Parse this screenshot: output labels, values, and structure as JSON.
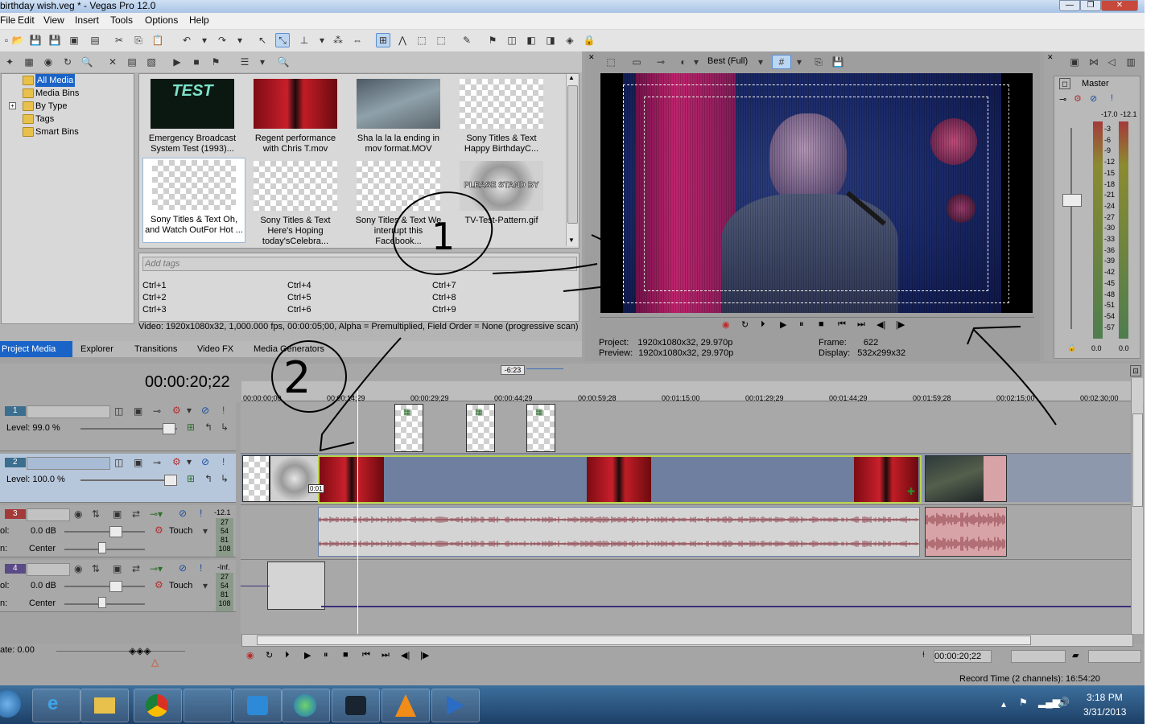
{
  "window": {
    "title": "birthday wish.veg * - Vegas Pro 12.0",
    "minimize": "—",
    "maximize": "❐",
    "close": "✕"
  },
  "menu": [
    "File",
    "Edit",
    "View",
    "Insert",
    "Tools",
    "Options",
    "Help"
  ],
  "media_tree": {
    "items": [
      "All Media",
      "Media Bins",
      "By Type",
      "Tags",
      "Smart Bins"
    ]
  },
  "media_items": [
    {
      "label": "Emergency Broadcast System Test (1993)...",
      "thumb": "TEST"
    },
    {
      "label": "Regent performance with Chris T.mov",
      "thumb": ""
    },
    {
      "label": "Sha la la la ending in mov format.MOV",
      "thumb": ""
    },
    {
      "label": "Sony Titles & Text Happy BirthdayC...",
      "thumb": ""
    },
    {
      "label": "Sony Titles & Text Oh, and Watch OutFor Hot ...",
      "thumb": ""
    },
    {
      "label": "Sony Titles & Text Here's Hoping today'sCelebra...",
      "thumb": ""
    },
    {
      "label": "Sony Titles & Text We interrupt this Facebook...",
      "thumb": ""
    },
    {
      "label": "TV-Test-Pattern.gif",
      "thumb": "PLEASE STAND BY"
    }
  ],
  "tags": {
    "placeholder": "Add tags",
    "shortcuts": [
      "Ctrl+1",
      "Ctrl+4",
      "Ctrl+7",
      "Ctrl+2",
      "Ctrl+5",
      "Ctrl+8",
      "Ctrl+3",
      "Ctrl+6",
      "Ctrl+9"
    ]
  },
  "media_info": "Video: 1920x1080x32, 1,000.000 fps, 00:00:05;00, Alpha = Premultiplied, Field Order = None (progressive scan)",
  "bottom_tabs": [
    "Project Media",
    "Explorer",
    "Transitions",
    "Video FX",
    "Media Generators"
  ],
  "preview": {
    "quality": "Best (Full)",
    "project_label": "Project:",
    "project_value": "1920x1080x32, 29.970p",
    "preview_label": "Preview:",
    "preview_value": "1920x1080x32, 29.970p",
    "frame_label": "Frame:",
    "frame_value": "622",
    "display_label": "Display:",
    "display_value": "532x299x32"
  },
  "master": {
    "label": "Master",
    "peak_left": "-17.0",
    "peak_right": "-12.1",
    "scale": [
      "3",
      "6",
      "9",
      "12",
      "15",
      "18",
      "21",
      "24",
      "27",
      "30",
      "33",
      "36",
      "39",
      "42",
      "45",
      "48",
      "51",
      "54",
      "57"
    ],
    "out_left": "0.0",
    "out_right": "0.0"
  },
  "timeline": {
    "timecode": "00:00:20;22",
    "region_label": "-6:23",
    "ticks": [
      "00:00:00;00",
      "00:00:14;29",
      "00:00:29;29",
      "00:00:44;29",
      "00:00:59;28",
      "00:01:15:00",
      "00:01:29;29",
      "00:01:44;29",
      "00:01:59;28",
      "00:02:15;00",
      "00:02:30;00"
    ],
    "clip_offset_label": "0:01"
  },
  "tracks": [
    {
      "num": "1",
      "level": "Level: 99.0 %"
    },
    {
      "num": "2",
      "level": "Level: 100.0 %"
    },
    {
      "num": "3",
      "vol": "0.0 dB",
      "pan": "Center",
      "mode": "Touch",
      "peak": "-12.1",
      "vol_label": "ol:",
      "pan_label": "n:"
    },
    {
      "num": "4",
      "vol": "0.0 dB",
      "pan": "Center",
      "mode": "Touch",
      "peak": "-Inf.",
      "vol_label": "ol:",
      "pan_label": "n:"
    }
  ],
  "transport": {
    "rate": "ate: 0.00",
    "cursor_time": "00:00:20;22",
    "record_time": "Record Time (2 channels): 16:54:20"
  },
  "taskbar": {
    "time": "3:18 PM",
    "date": "3/31/2013"
  },
  "annotations": [
    "1",
    "2"
  ],
  "colors": {
    "accent": "#1a63c7",
    "video_track": "#6a80a8",
    "audio_sel": "#d6c0c4",
    "track3": "#a33a3a",
    "track4": "#5a4a86"
  }
}
